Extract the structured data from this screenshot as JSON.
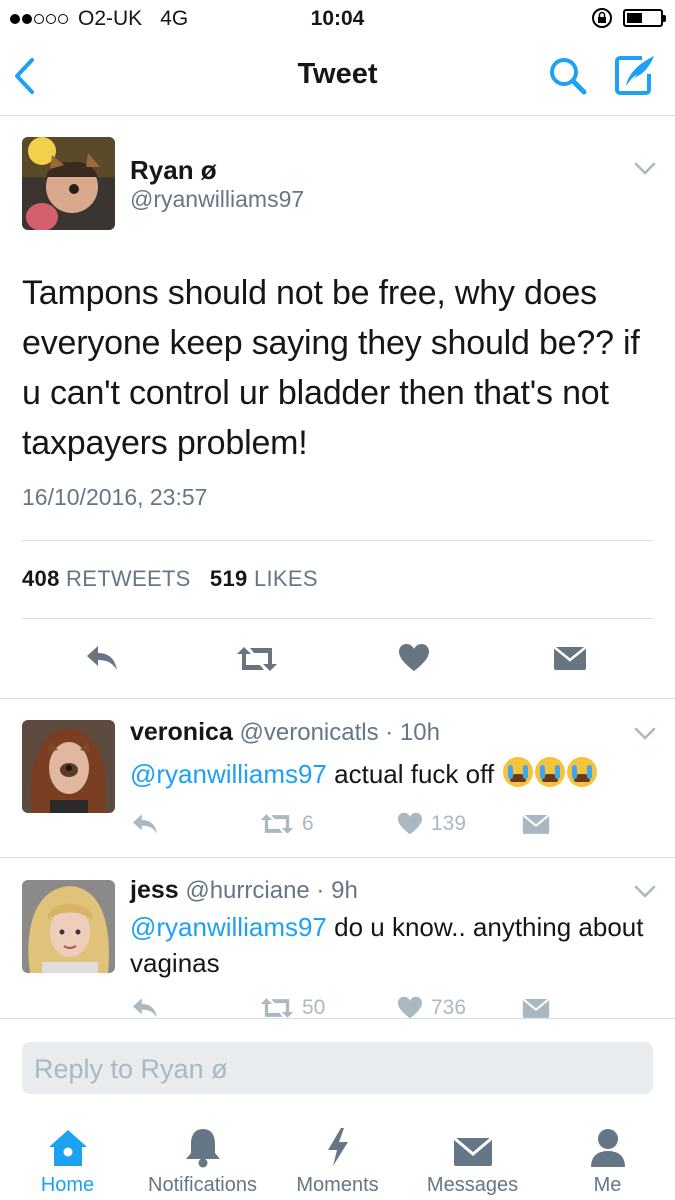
{
  "status_bar": {
    "carrier": "O2-UK",
    "network": "4G",
    "time": "10:04"
  },
  "nav": {
    "title": "Tweet"
  },
  "tweet": {
    "name": "Ryan ø",
    "handle": "@ryanwilliams97",
    "text": "Tampons should not be free, why does everyone keep saying they should be?? if u can't control ur bladder then that's not taxpayers problem!",
    "timestamp": "16/10/2016, 23:57",
    "retweet_count": "408",
    "retweet_label": "RETWEETS",
    "like_count": "519",
    "like_label": "LIKES"
  },
  "replies": [
    {
      "name": "veronica",
      "handle": "@veronicatls",
      "age": "10h",
      "mention": "@ryanwilliams97",
      "text": "actual fuck off",
      "emoji": "crying-face-emoji x3",
      "retweets": "6",
      "likes": "139"
    },
    {
      "name": "jess",
      "handle": "@hurrciane",
      "age": "9h",
      "mention": "@ryanwilliams97",
      "text": "do u know.. anything about vaginas",
      "retweets": "50",
      "likes": "736"
    }
  ],
  "reply_field": {
    "placeholder": "Reply to Ryan ø"
  },
  "tabs": [
    {
      "label": "Home",
      "icon": "home-icon",
      "active": true
    },
    {
      "label": "Notifications",
      "icon": "bell-icon",
      "active": false
    },
    {
      "label": "Moments",
      "icon": "lightning-icon",
      "active": false
    },
    {
      "label": "Messages",
      "icon": "envelope-icon",
      "active": false
    },
    {
      "label": "Me",
      "icon": "person-icon",
      "active": false
    }
  ],
  "colors": {
    "accent": "#1da1f2",
    "muted": "#657786",
    "icon_gray": "#aab8c2",
    "action_dark": "#66757f"
  }
}
